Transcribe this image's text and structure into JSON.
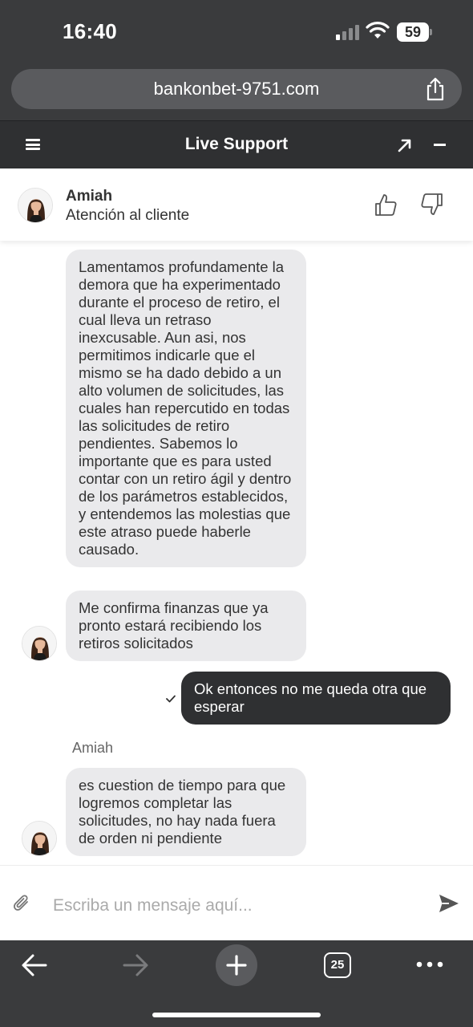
{
  "status_bar": {
    "time": "16:40",
    "battery": "59"
  },
  "browser": {
    "url": "bankonbet-9751.com",
    "tab_count": "25"
  },
  "chat_header": {
    "title": "Live Support"
  },
  "agent": {
    "name": "Amiah",
    "role": "Atención al cliente"
  },
  "messages": [
    {
      "from": "agent",
      "text": "Lamentamos profundamente la demora que ha experimentado durante el proceso de retiro, el cual lleva un retraso inexcusable. Aun asi, nos permitimos indicarle que el mismo se ha dado debido a un alto volumen de solicitudes, las cuales han repercutido en todas las solicitudes de retiro pendientes. Sabemos lo importante que es para usted contar con un retiro ágil y dentro de los parámetros establecidos, y entendemos las molestias que este atraso puede haberle causado."
    },
    {
      "from": "agent",
      "text": "Me confirma finanzas que ya pronto estará recibiendo los retiros solicitados"
    },
    {
      "from": "user",
      "text": "Ok entonces no me queda otra que esperar"
    },
    {
      "from": "agent",
      "sender": "Amiah",
      "text": "es cuestion de tiempo para que logremos completar las solicitudes, no hay nada fuera de orden ni pendiente"
    }
  ],
  "composer": {
    "placeholder": "Escriba un mensaje aquí..."
  },
  "colors": {
    "header_bg": "#2f3032",
    "browser_chrome": "#3a3b3d",
    "agent_bubble": "#eaeaec",
    "user_bubble": "#2f3032"
  }
}
